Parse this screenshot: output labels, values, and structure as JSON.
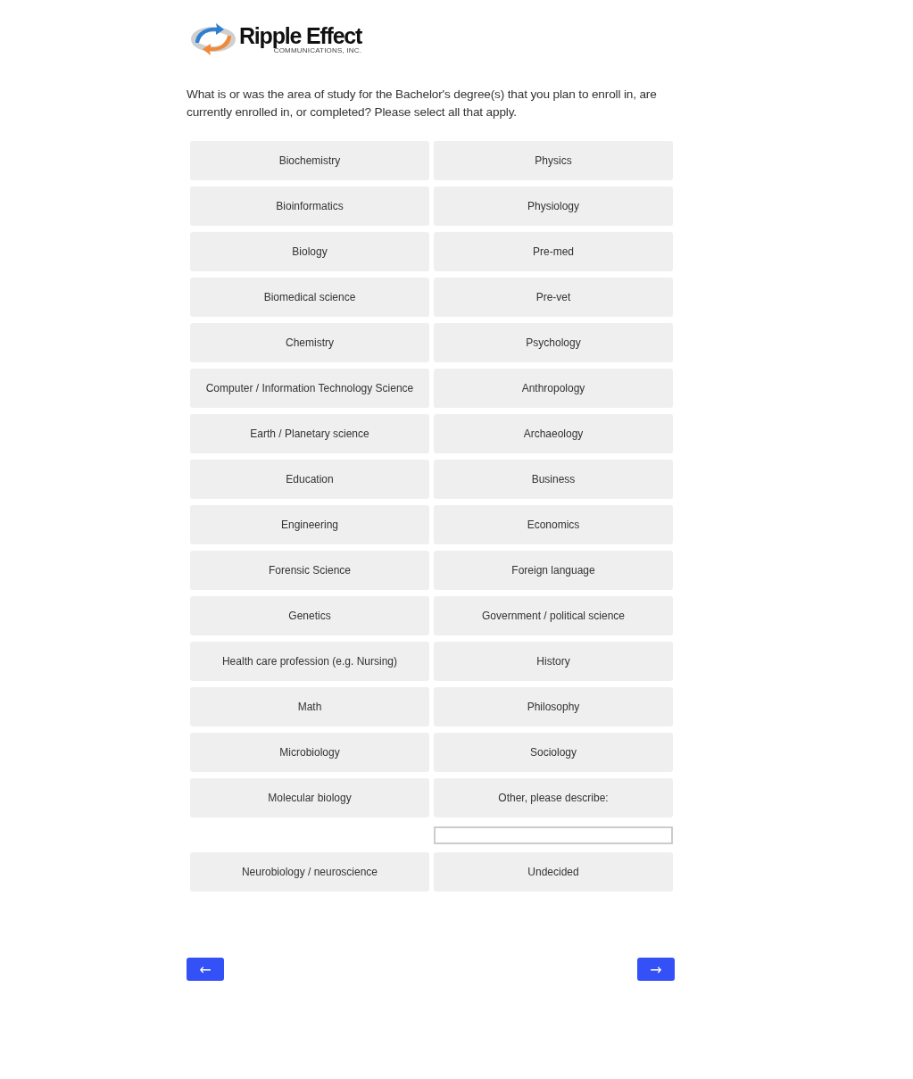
{
  "logo": {
    "name": "Ripple Effect",
    "tagline": "COMMUNICATIONS, INC."
  },
  "question": "What is or was the area of study for the Bachelor's degree(s) that you plan to enroll in, are currently enrolled in, or completed? Please select all that apply.",
  "options": [
    {
      "kind": "choice",
      "label": "Biochemistry",
      "selected": false
    },
    {
      "kind": "choice",
      "label": "Physics",
      "selected": false
    },
    {
      "kind": "choice",
      "label": "Bioinformatics",
      "selected": false
    },
    {
      "kind": "choice",
      "label": "Physiology",
      "selected": false
    },
    {
      "kind": "choice",
      "label": "Biology",
      "selected": false
    },
    {
      "kind": "choice",
      "label": "Pre-med",
      "selected": false
    },
    {
      "kind": "choice",
      "label": "Biomedical science",
      "selected": false
    },
    {
      "kind": "choice",
      "label": "Pre-vet",
      "selected": false
    },
    {
      "kind": "choice",
      "label": "Chemistry",
      "selected": false
    },
    {
      "kind": "choice",
      "label": "Psychology",
      "selected": false
    },
    {
      "kind": "choice",
      "label": "Computer / Information Technology Science",
      "selected": false
    },
    {
      "kind": "choice",
      "label": "Anthropology",
      "selected": false
    },
    {
      "kind": "choice",
      "label": "Earth / Planetary science",
      "selected": false
    },
    {
      "kind": "choice",
      "label": "Archaeology",
      "selected": false
    },
    {
      "kind": "choice",
      "label": "Education",
      "selected": false
    },
    {
      "kind": "choice",
      "label": "Business",
      "selected": false
    },
    {
      "kind": "choice",
      "label": "Engineering",
      "selected": false
    },
    {
      "kind": "choice",
      "label": "Economics",
      "selected": false
    },
    {
      "kind": "choice",
      "label": "Forensic Science",
      "selected": false
    },
    {
      "kind": "choice",
      "label": "Foreign language",
      "selected": false
    },
    {
      "kind": "choice",
      "label": "Genetics",
      "selected": false
    },
    {
      "kind": "choice",
      "label": "Government / political science",
      "selected": false
    },
    {
      "kind": "choice",
      "label": "Health care profession (e.g. Nursing)",
      "selected": false
    },
    {
      "kind": "choice",
      "label": "History",
      "selected": false
    },
    {
      "kind": "choice",
      "label": "Math",
      "selected": false
    },
    {
      "kind": "choice",
      "label": "Philosophy",
      "selected": false
    },
    {
      "kind": "choice",
      "label": "Microbiology",
      "selected": false
    },
    {
      "kind": "choice",
      "label": "Sociology",
      "selected": false
    },
    {
      "kind": "choice",
      "label": "Molecular biology",
      "selected": false
    },
    {
      "kind": "other",
      "label": "Other, please describe:",
      "selected": false
    },
    {
      "kind": "choice",
      "label": "Neurobiology / neuroscience",
      "selected": false
    },
    {
      "kind": "choice",
      "label": "Undecided",
      "selected": false
    }
  ],
  "nav": {
    "back": "←",
    "next": "→"
  }
}
